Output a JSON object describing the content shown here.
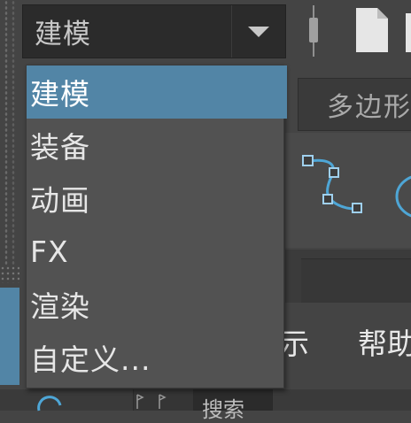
{
  "toolbar": {
    "mode_select_value": "建模"
  },
  "mode_menu": {
    "items": [
      {
        "label": "建模",
        "selected": true
      },
      {
        "label": "装备",
        "selected": false
      },
      {
        "label": "动画",
        "selected": false
      },
      {
        "label": "FX",
        "selected": false
      },
      {
        "label": "渲染",
        "selected": false
      },
      {
        "label": "自定义...",
        "selected": false
      }
    ]
  },
  "shelf": {
    "tab_label": "多边形"
  },
  "menubar": {
    "show_label": "示",
    "help_label": "帮助"
  },
  "bottom": {
    "search_label": "搜索"
  },
  "icons": {
    "dropdown_arrow": "chevron-down-icon",
    "file": "file-icon",
    "curve": "curve-tool-icon",
    "circle": "circle-icon"
  },
  "colors": {
    "accent": "#5285a6",
    "menu_bg": "#525252",
    "app_bg": "#444444",
    "field_bg": "#2b2b2b"
  }
}
